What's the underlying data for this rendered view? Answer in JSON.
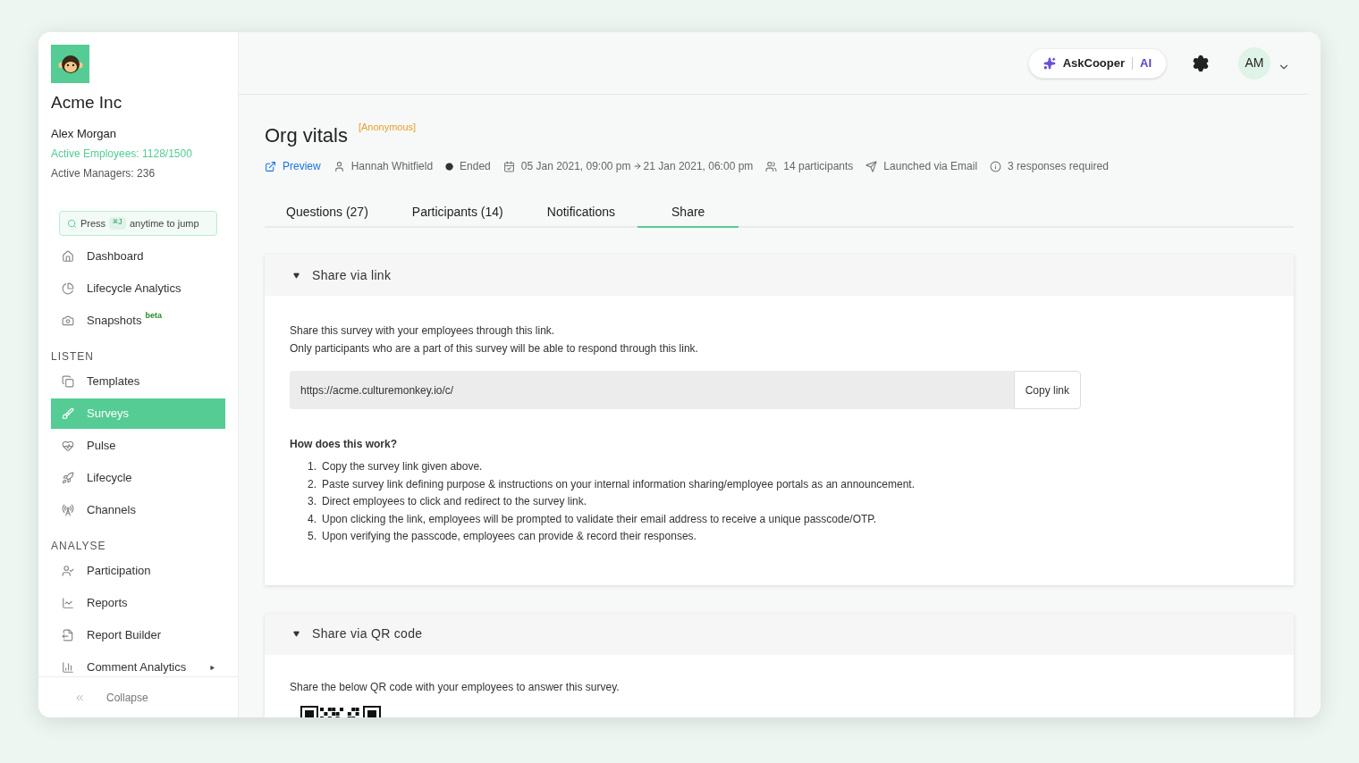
{
  "sidebar": {
    "company": "Acme Inc",
    "user": "Alex Morgan",
    "active_employees": "Active Employees: 1128/1500",
    "active_managers": "Active Managers: 236",
    "jump": {
      "before": "Press",
      "key": "⌘J",
      "after": "anytime to jump"
    },
    "top_items": [
      {
        "label": "Dashboard",
        "selected": false
      },
      {
        "label": "Lifecycle Analytics",
        "selected": false
      },
      {
        "label": "Snapshots",
        "badge": "beta",
        "selected": false
      }
    ],
    "sections": [
      {
        "heading": "LISTEN",
        "items": [
          {
            "label": "Templates",
            "selected": false
          },
          {
            "label": "Surveys",
            "selected": true
          },
          {
            "label": "Pulse",
            "selected": false
          },
          {
            "label": "Lifecycle",
            "selected": false
          },
          {
            "label": "Channels",
            "selected": false
          }
        ]
      },
      {
        "heading": "ANALYSE",
        "items": [
          {
            "label": "Participation",
            "selected": false
          },
          {
            "label": "Reports",
            "selected": false
          },
          {
            "label": "Report Builder",
            "selected": false
          },
          {
            "label": "Comment Analytics",
            "selected": false,
            "has_submenu": true
          }
        ]
      }
    ],
    "collapse": "Collapse"
  },
  "header": {
    "ask": "AskCooper",
    "ai": "AI",
    "avatar": "AM"
  },
  "survey": {
    "title": "Org vitals",
    "tag": "[Anonymous]",
    "meta": [
      {
        "kind": "link",
        "text": "Preview"
      },
      {
        "kind": "person",
        "text": "Hannah Whitfield"
      },
      {
        "kind": "status",
        "text": "Ended"
      },
      {
        "kind": "dates",
        "text": "05 Jan 2021, 09:00 pm",
        "end": "21 Jan 2021, 06:00 pm"
      },
      {
        "kind": "people",
        "text": "14 participants"
      },
      {
        "kind": "send",
        "text": "Launched via Email"
      },
      {
        "kind": "info",
        "text": "3 responses required"
      }
    ]
  },
  "tabs": [
    {
      "label": "Questions (27)",
      "selected": false
    },
    {
      "label": "Participants (14)",
      "selected": false
    },
    {
      "label": "Notifications",
      "selected": false
    },
    {
      "label": "Share",
      "selected": true
    }
  ],
  "link_panel": {
    "title": "Share via link",
    "expanded": true,
    "intro": [
      "Share this survey with your employees through this link.",
      "Only participants who are a part of this survey will be able to respond through this link."
    ],
    "url": "https://acme.culturemonkey.io/c/",
    "copy": "Copy link",
    "how_title": "How does this work?",
    "steps": [
      {
        "number": "1.",
        "text": "Copy the survey link given above."
      },
      {
        "number": "2.",
        "text": "Paste survey link defining purpose & instructions on your internal information sharing/employee portals as an announcement."
      },
      {
        "number": "3.",
        "text": "Direct employees to click and redirect to the survey link."
      },
      {
        "number": "4.",
        "text": "Upon clicking the link, employees will be prompted to validate their email address to receive a unique passcode/OTP."
      },
      {
        "number": "5.",
        "text": "Upon verifying the passcode, employees can provide & record their responses."
      }
    ]
  },
  "qr_panel": {
    "title": "Share via QR code",
    "expanded": true,
    "intro": "Share the below QR code with your employees to answer this survey."
  }
}
